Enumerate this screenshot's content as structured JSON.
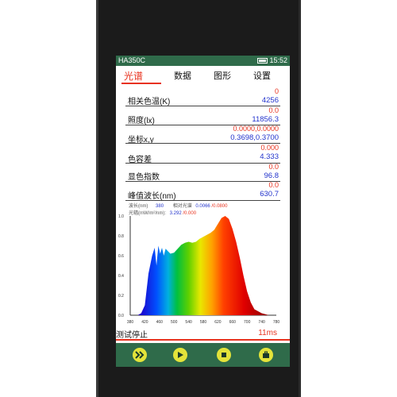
{
  "statusbar": {
    "title": "HA350C",
    "battery_icon": "battery-icon",
    "time": "15:52"
  },
  "tabs": [
    {
      "label": "光谱",
      "active": true
    },
    {
      "label": "数据",
      "active": false
    },
    {
      "label": "图形",
      "active": false
    },
    {
      "label": "设置",
      "active": false
    }
  ],
  "rows": [
    {
      "label": "相关色温(K)",
      "v1": "0",
      "v2": "4256"
    },
    {
      "label": "照度(lx)",
      "v1": "0.0",
      "v2": "11856.3"
    },
    {
      "label": "坐标x,y",
      "v1": "0.0000,0.0000",
      "v2": "0.3698,0.3700"
    },
    {
      "label": "色容差",
      "v1": "0.000",
      "v2": "4.333"
    },
    {
      "label": "显色指数",
      "v1": "0.0",
      "v2": "96.8"
    },
    {
      "label": "峰值波长(nm)",
      "v1": "0.0",
      "v2": "630.7"
    }
  ],
  "info": {
    "wavelength_label": "波长(nm)",
    "wavelength_value": "380",
    "relative_label": "相对光谱",
    "relative_value": "0.0066",
    "relative_ref": "/0.0800",
    "power_label": "光辐(mW/m²/nm):",
    "power_value": "3.292",
    "power_ref": "/0.000"
  },
  "chart_data": {
    "type": "area",
    "xlim": [
      380,
      780
    ],
    "ylim": [
      0,
      1.0
    ],
    "xticks": [
      "380",
      "420",
      "460",
      "500",
      "540",
      "580",
      "620",
      "660",
      "700",
      "740",
      "780"
    ],
    "yticks": [
      "0.0",
      "0.2",
      "0.4",
      "0.6",
      "0.8",
      "1.0"
    ],
    "grid": false,
    "x": [
      380,
      400,
      410,
      420,
      430,
      440,
      447,
      452,
      457,
      462,
      467,
      472,
      477,
      482,
      490,
      500,
      510,
      520,
      530,
      540,
      550,
      560,
      570,
      580,
      590,
      600,
      610,
      620,
      630,
      640,
      650,
      660,
      670,
      680,
      690,
      700,
      710,
      720,
      740,
      760,
      780
    ],
    "values": [
      0.0,
      0.0,
      0.02,
      0.1,
      0.42,
      0.6,
      0.68,
      0.5,
      0.7,
      0.62,
      0.68,
      0.6,
      0.67,
      0.65,
      0.62,
      0.63,
      0.67,
      0.71,
      0.73,
      0.74,
      0.73,
      0.74,
      0.77,
      0.79,
      0.81,
      0.83,
      0.86,
      0.92,
      0.98,
      1.0,
      0.97,
      0.87,
      0.74,
      0.58,
      0.4,
      0.24,
      0.13,
      0.06,
      0.02,
      0.0,
      0.0
    ]
  },
  "footer": {
    "status": "测试停止",
    "time": "11ms"
  },
  "controls": [
    {
      "icon": "fast-forward-icon"
    },
    {
      "icon": "play-icon"
    },
    {
      "icon": "stop-icon"
    },
    {
      "icon": "briefcase-icon"
    }
  ]
}
